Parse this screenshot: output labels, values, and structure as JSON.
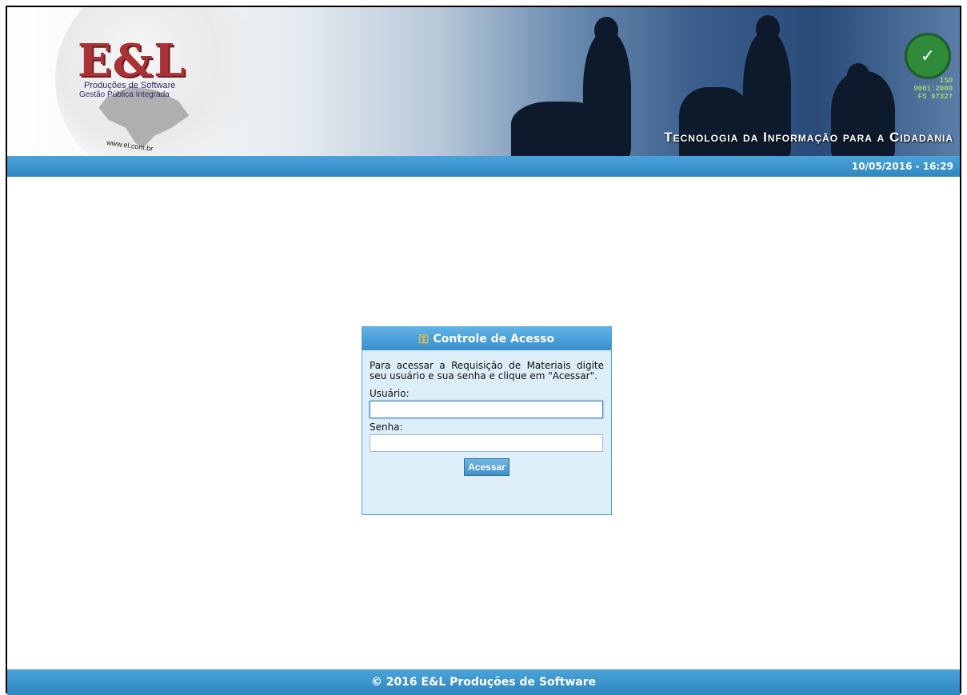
{
  "header": {
    "logo_text": "E&L",
    "logo_line1": "Produções de Software",
    "logo_line2": "Gestão Pública Integrada",
    "logo_url": "www.el.com.br",
    "iso_line1": "ISO 9001:2000",
    "iso_line2": "FS 97327",
    "tagline": "Tecnologia da Informação para a Cidadania",
    "datetime": "10/05/2016 - 16:29"
  },
  "login": {
    "title": "Controle de Acesso",
    "description": "Para acessar a Requisição de Materiais digite seu usuário e sua senha e clique em \"Acessar\".",
    "user_label": "Usuário:",
    "user_value": "",
    "password_label": "Senha:",
    "password_value": "",
    "submit_label": "Acessar"
  },
  "footer": {
    "text": "© 2016 E&L Produções de Software"
  },
  "colors": {
    "accent": "#3a8fcd",
    "panel_bg": "#ddeef8",
    "logo_red": "#a83236"
  }
}
